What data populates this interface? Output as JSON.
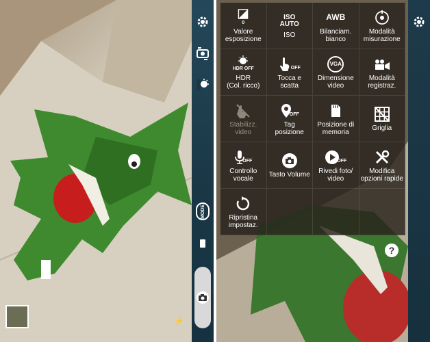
{
  "left_camera": {
    "mode_button_label": "MODE",
    "flash_badge": "⚡"
  },
  "menu": {
    "items": [
      {
        "label": "Valore\nesposizione",
        "icon": "exposure-icon",
        "value": "0"
      },
      {
        "label": "ISO",
        "icon": "iso-icon",
        "value": "ISO\nAUTO"
      },
      {
        "label": "Bilanciam.\nbianco",
        "icon": "awb-icon",
        "value": "AWB"
      },
      {
        "label": "Modalità\nmisurazione",
        "icon": "metering-icon"
      },
      {
        "label": "HDR\n(Col. ricco)",
        "icon": "hdr-icon",
        "value": "HDR OFF"
      },
      {
        "label": "Tocca e\nscatta",
        "icon": "touch-shot-icon",
        "value": "OFF"
      },
      {
        "label": "Dimensione\nvideo",
        "icon": "video-size-icon",
        "value": "VGA"
      },
      {
        "label": "Modalità\nregistraz.",
        "icon": "recording-mode-icon"
      },
      {
        "label": "Stabilizz.\nvideo",
        "icon": "video-stabilization-icon",
        "disabled": true
      },
      {
        "label": "Tag\nposizione",
        "icon": "location-tag-icon",
        "value": "OFF"
      },
      {
        "label": "Posizione di\nmemoria",
        "icon": "memory-location-icon"
      },
      {
        "label": "Griglia",
        "icon": "grid-icon"
      },
      {
        "label": "Controllo\nvocale",
        "icon": "voice-control-icon",
        "value": "OFF"
      },
      {
        "label": "Tasto Volume",
        "icon": "volume-key-icon"
      },
      {
        "label": "Rivedi foto/\nvideo",
        "icon": "review-icon",
        "value": "OFF"
      },
      {
        "label": "Modifica\nopzioni rapide",
        "icon": "edit-shortcuts-icon"
      },
      {
        "label": "Ripristina\nimpostaz.",
        "icon": "reset-icon"
      }
    ]
  },
  "help_label": "?"
}
